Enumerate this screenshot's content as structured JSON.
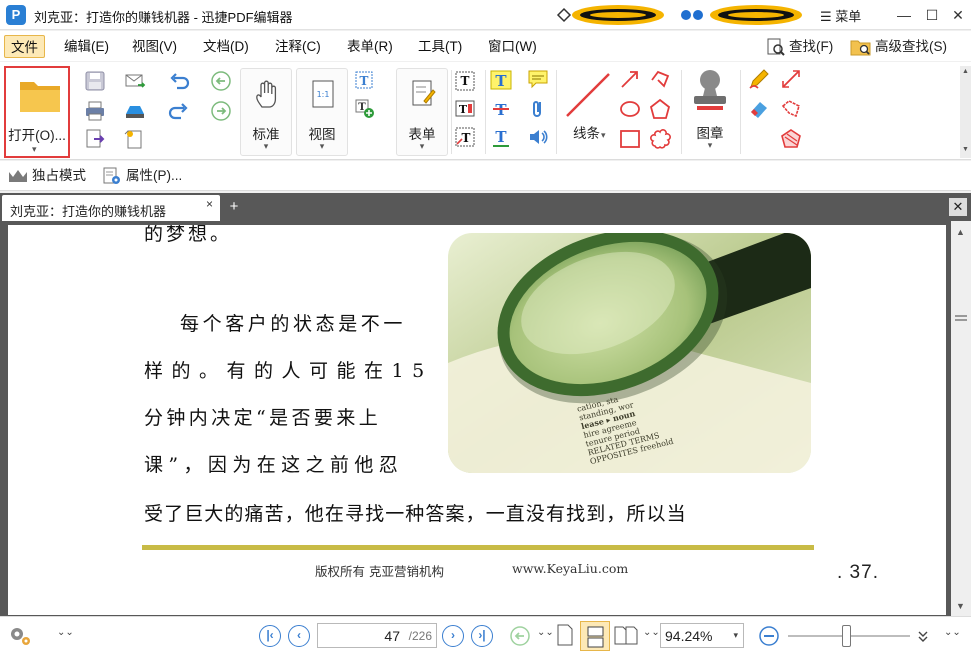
{
  "window": {
    "title": "刘克亚：打造你的赚钱机器 - 迅捷PDF编辑器",
    "app_logo": "P",
    "menu_label": "菜单",
    "menu_icon": "hamburger-icon",
    "min": "—",
    "max": "☐",
    "close": "✕"
  },
  "menubar": {
    "items": [
      "文件",
      "编辑(E)",
      "视图(V)",
      "文档(D)",
      "注释(C)",
      "表单(R)",
      "工具(T)",
      "窗口(W)"
    ],
    "find": "查找(F)",
    "advanced_find": "高级查找(S)"
  },
  "ribbon": {
    "open_label": "打开(O)...",
    "standard_label": "标准",
    "view_label": "视图",
    "form_label": "表单",
    "line_label": "线条",
    "stamp_label": "图章",
    "dropdown_arrow": "▾"
  },
  "modebar": {
    "exclusive": "独占模式",
    "properties": "属性(P)..."
  },
  "tabs": {
    "doc_tab": "刘克亚：打造你的赚钱机器",
    "doc_tab_close": "×",
    "add": "+",
    "close_all": "✕"
  },
  "page": {
    "line0": "的梦想。",
    "line1": "每个客户的状态是不一",
    "line2": "样的。有的人可能在15",
    "line3": "分钟内决定“是否要来上",
    "line4": "课”，因为在这之前他忍",
    "line5": "受了巨大的痛苦，他在寻找一种答案，一直没有找到，所以当",
    "footer_left": "版权所有  克亚营销机构",
    "footer_url": "www.KeyaLiu.com",
    "page_number": ". 37.",
    "photo_text": [
      "cation, sta",
      "standing, wor",
      "lease ▸ noun",
      "hire  agreeme",
      "tenure  period",
      "RELATED TERMS",
      "OPPOSITES freehold"
    ]
  },
  "statusbar": {
    "current_page": "47",
    "total_pages": "/226",
    "zoom": "94.24%",
    "first": "|‹",
    "prev": "‹",
    "next": "›",
    "last": "›|",
    "zoom_arrow": "▾",
    "zoom_level": 0.48
  },
  "colors": {
    "accent_blue": "#3b7fd0",
    "highlight_red": "#e23c3c",
    "rule_olive": "#c8bb46",
    "viewer_bg": "#585858"
  }
}
